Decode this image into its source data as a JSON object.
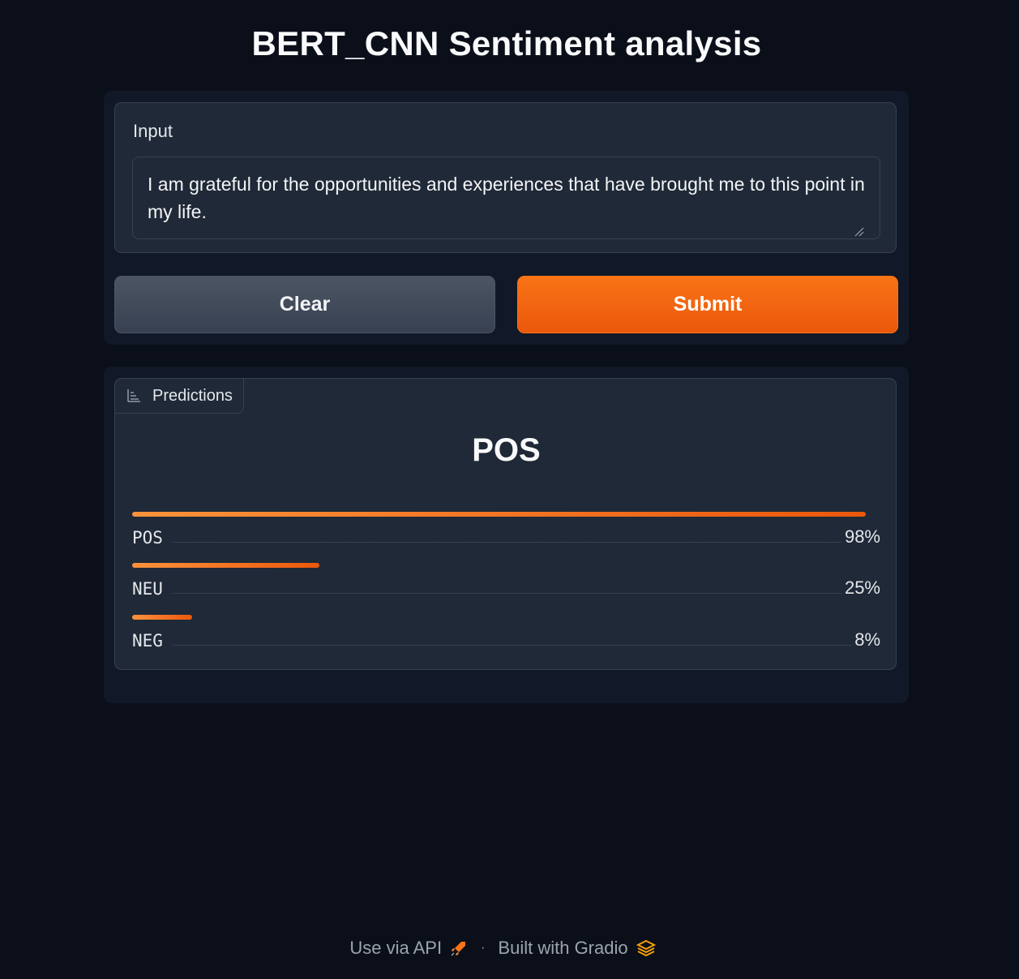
{
  "app": {
    "title": "BERT_CNN Sentiment analysis"
  },
  "input": {
    "label": "Input",
    "value": "I am grateful for the opportunities and experiences that have brought me to this point in my life."
  },
  "buttons": {
    "clear_label": "Clear",
    "submit_label": "Submit"
  },
  "output": {
    "tab_label": "Predictions",
    "top_label": "POS",
    "confidences": [
      {
        "label": "POS",
        "value_text": "98%",
        "fraction": 0.98
      },
      {
        "label": "NEU",
        "value_text": "25%",
        "fraction": 0.25
      },
      {
        "label": "NEG",
        "value_text": "8%",
        "fraction": 0.08
      }
    ]
  },
  "footer": {
    "api_label": "Use via API",
    "separator": "·",
    "built_label": "Built with Gradio",
    "api_icon": "rocket-icon",
    "built_icon": "gradio-logo-icon"
  },
  "colors": {
    "accent": "#f97316",
    "background": "#0b0f19",
    "panel": "#111827",
    "block": "#1f2937"
  }
}
